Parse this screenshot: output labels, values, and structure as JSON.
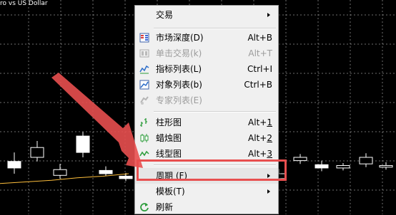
{
  "chart": {
    "title": "ro vs US Dollar",
    "colors": {
      "background": "#000000",
      "grid": "#c8c8c8",
      "candle": "#ffffff",
      "ma_line": "#ffbf3c"
    },
    "candles": [
      {
        "o": 0.55,
        "c": 0.47,
        "h": 0.66,
        "l": 0.4
      },
      {
        "o": 0.6,
        "c": 0.72,
        "h": 0.8,
        "l": 0.55
      },
      {
        "o": 0.38,
        "c": 0.45,
        "h": 0.52,
        "l": 0.34
      },
      {
        "o": 0.86,
        "c": 0.66,
        "h": 0.91,
        "l": 0.6
      },
      {
        "o": 0.44,
        "c": 0.4,
        "h": 0.49,
        "l": 0.37
      },
      {
        "o": 0.37,
        "c": 0.34,
        "h": 0.41,
        "l": 0.31
      },
      {
        "o": 0.34,
        "c": 0.4,
        "h": 0.46,
        "l": 0.31
      },
      {
        "o": 0.56,
        "c": 0.6,
        "h": 0.64,
        "l": 0.52
      },
      {
        "o": 0.51,
        "c": 0.47,
        "h": 0.56,
        "l": 0.43
      },
      {
        "o": 0.47,
        "c": 0.5,
        "h": 0.53,
        "l": 0.44
      },
      {
        "o": 0.52,
        "c": 0.6,
        "h": 0.65,
        "l": 0.48
      },
      {
        "o": 0.48,
        "c": 0.5,
        "h": 0.54,
        "l": 0.45
      }
    ],
    "ma_line": [
      0.28,
      0.3,
      0.32,
      0.35,
      0.37,
      0.4
    ]
  },
  "context_menu": {
    "items": [
      {
        "label": "交易",
        "shortcut": "",
        "submenu": true,
        "disabled": false,
        "icon": ""
      },
      {
        "label": "市场深度(D)",
        "shortcut": "Alt+B",
        "submenu": false,
        "disabled": false,
        "icon": "market-depth-icon"
      },
      {
        "label": "单击交易(k)",
        "shortcut": "Alt+T",
        "submenu": false,
        "disabled": true,
        "icon": "one-click-trading-icon"
      },
      {
        "label": "指标列表(L)",
        "shortcut": "Ctrl+I",
        "submenu": false,
        "disabled": false,
        "icon": "indicators-list-icon"
      },
      {
        "label": "对象列表(b)",
        "shortcut": "Ctrl+B",
        "submenu": false,
        "disabled": false,
        "icon": "objects-list-icon"
      },
      {
        "label": "专家列表(E)",
        "shortcut": "",
        "submenu": false,
        "disabled": true,
        "icon": "experts-list-icon"
      },
      {
        "label": "柱形图",
        "shortcut_prefix": "Alt+",
        "shortcut_key": "1",
        "submenu": false,
        "disabled": false,
        "icon": "bar-chart-icon"
      },
      {
        "label": "蜡烛图",
        "shortcut_prefix": "Alt+",
        "shortcut_key": "2",
        "submenu": false,
        "disabled": false,
        "icon": "candlestick-chart-icon"
      },
      {
        "label": "线型图",
        "shortcut_prefix": "Alt+",
        "shortcut_key": "3",
        "submenu": false,
        "disabled": false,
        "icon": "line-chart-icon"
      },
      {
        "label": "周期 (F)",
        "shortcut": "",
        "submenu": true,
        "disabled": false,
        "icon": "",
        "highlighted": true
      },
      {
        "label": "模板(T)",
        "shortcut": "",
        "submenu": true,
        "disabled": false,
        "icon": ""
      },
      {
        "label": "刷新",
        "shortcut": "",
        "submenu": false,
        "disabled": false,
        "icon": "refresh-icon"
      }
    ]
  },
  "annotation": {
    "color": "#e84f4f"
  }
}
